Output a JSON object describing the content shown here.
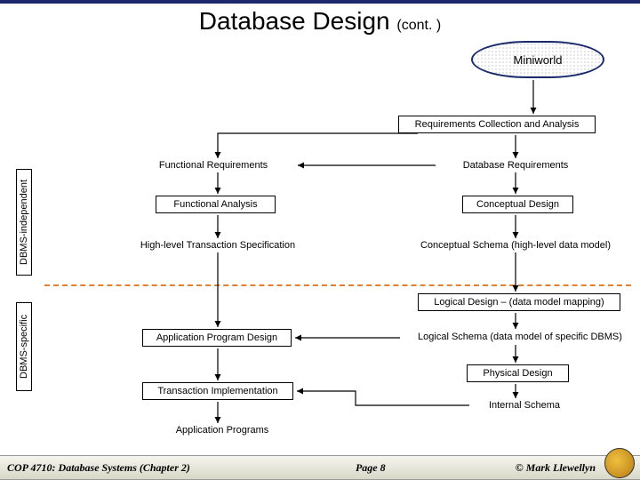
{
  "title": {
    "main": "Database Design",
    "cont": "(cont. )"
  },
  "miniworld": "Miniworld",
  "nodes": {
    "reqcoll": "Requirements Collection and Analysis",
    "funcreq": "Functional Requirements",
    "dbreq": "Database Requirements",
    "funcanal": "Functional Analysis",
    "concdes": "Conceptual Design",
    "hltspec": "High-level Transaction Specification",
    "concschema": "Conceptual Schema (high-level data model)",
    "logdes": "Logical Design – (data model mapping)",
    "appdes": "Application Program Design",
    "logschema": "Logical Schema (data model of specific DBMS)",
    "physdes": "Physical Design",
    "transimpl": "Transaction Implementation",
    "intschema": "Internal Schema",
    "appprog": "Application Programs"
  },
  "vlabels": {
    "indep": "DBMS-independent",
    "spec": "DBMS-specific"
  },
  "footer": {
    "left": "COP 4710: Database Systems  (Chapter 2)",
    "center": "Page 8",
    "right": "© Mark Llewellyn"
  }
}
